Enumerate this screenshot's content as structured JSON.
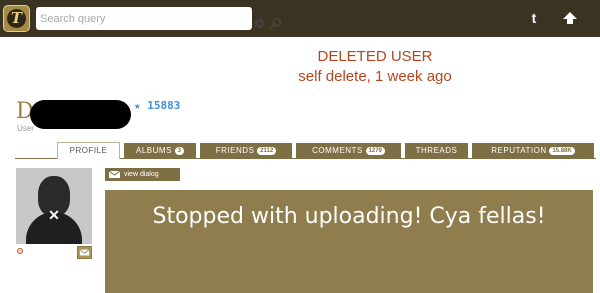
{
  "colors": {
    "topbar_bg": "#3b3322",
    "accent_gold": "#7e6f45",
    "message_bg": "#8f7d4d",
    "deleted_text": "#b6451c",
    "score_blue": "#3f8fd9"
  },
  "header": {
    "logo_letter": "T",
    "search": {
      "placeholder": "Search query",
      "value": ""
    },
    "icons": [
      "gear-icon",
      "search-icon",
      "tumblr-icon",
      "upload-icon"
    ],
    "tumblr_label": "t"
  },
  "banner": {
    "title": "DELETED USER",
    "subtitle": "self delete, 1 week ago"
  },
  "user": {
    "initial": "D",
    "score": "★ 15883",
    "role": "User"
  },
  "tabs": [
    {
      "label": "PROFILE",
      "badge": ""
    },
    {
      "label": "ALBUMS",
      "badge": "3"
    },
    {
      "label": "FRIENDS",
      "badge": "2112"
    },
    {
      "label": "COMMENTS",
      "badge": "1279"
    },
    {
      "label": "THREADS",
      "badge": ""
    },
    {
      "label": "REPUTATION",
      "badge": "15.88K"
    }
  ],
  "content": {
    "view_dialog_label": "view dialog",
    "message": "Stopped with uploading! Cya fellas!"
  }
}
